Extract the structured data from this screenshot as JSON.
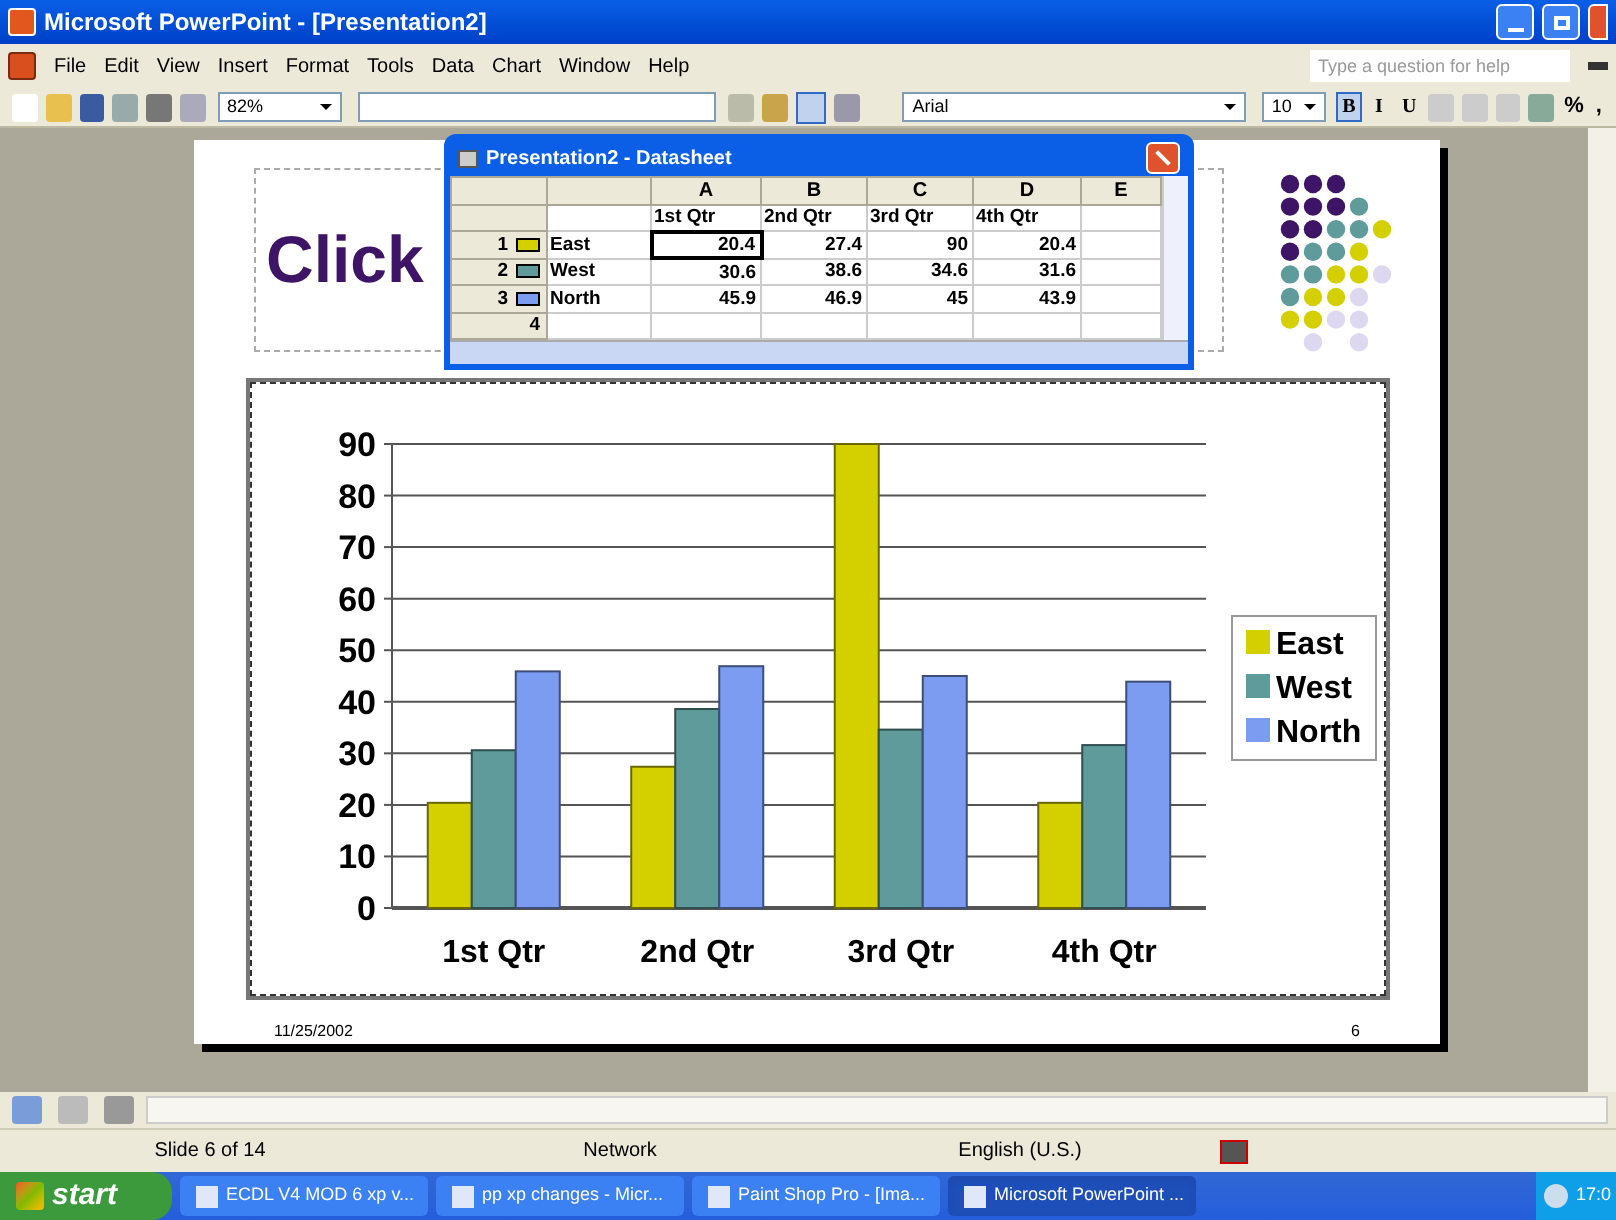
{
  "window": {
    "title": "Microsoft PowerPoint - [Presentation2]"
  },
  "menu": [
    "File",
    "Edit",
    "View",
    "Insert",
    "Format",
    "Tools",
    "Data",
    "Chart",
    "Window",
    "Help"
  ],
  "help_box": {
    "placeholder": "Type a question for help"
  },
  "toolbar": {
    "zoom": "82%",
    "font": "Arial",
    "font_size": "10",
    "format_buttons": [
      {
        "label": "B",
        "selected": true
      },
      {
        "label": "I",
        "selected": false
      },
      {
        "label": "U",
        "selected": false
      }
    ],
    "number_buttons": [
      "%",
      ","
    ]
  },
  "datasheet": {
    "title": "Presentation2 - Datasheet",
    "columns": [
      "A",
      "B",
      "C",
      "D",
      "E"
    ],
    "header": [
      "1st Qtr",
      "2nd Qtr",
      "3rd Qtr",
      "4th Qtr"
    ],
    "rows": [
      {
        "index": "1",
        "label": "East",
        "color": "#d4d000",
        "values": [
          {
            "text": "20.4",
            "selected": true
          },
          {
            "text": "27.4",
            "selected": false
          },
          {
            "text": "90",
            "selected": false
          },
          {
            "text": "20.4",
            "selected": false
          }
        ]
      },
      {
        "index": "2",
        "label": "West",
        "color": "#5f9b9b",
        "values": [
          {
            "text": "30.6",
            "selected": false
          },
          {
            "text": "38.6",
            "selected": false
          },
          {
            "text": "34.6",
            "selected": false
          },
          {
            "text": "31.6",
            "selected": false
          }
        ]
      },
      {
        "index": "3",
        "label": "North",
        "color": "#7b9cf0",
        "values": [
          {
            "text": "45.9",
            "selected": false
          },
          {
            "text": "46.9",
            "selected": false
          },
          {
            "text": "45",
            "selected": false
          },
          {
            "text": "43.9",
            "selected": false
          }
        ]
      },
      {
        "index": "4",
        "label": "",
        "color": "",
        "values": []
      }
    ]
  },
  "slide": {
    "title": "Click",
    "footer_date": "11/25/2002",
    "page_number": "6",
    "chart_data": {
      "type": "bar",
      "grid": true,
      "legend": "right",
      "categories": [
        "1st Qtr",
        "2nd Qtr",
        "3rd Qtr",
        "4th Qtr"
      ],
      "ylim": [
        0,
        90
      ],
      "yticks": [
        0,
        10,
        20,
        30,
        40,
        50,
        60,
        70,
        80,
        90
      ],
      "series": [
        {
          "name": "East",
          "color": "#d4d000",
          "values": [
            20.4,
            27.4,
            90,
            20.4
          ]
        },
        {
          "name": "West",
          "color": "#5f9b9b",
          "values": [
            30.6,
            38.6,
            34.6,
            31.6
          ]
        },
        {
          "name": "North",
          "color": "#7b9cf0",
          "values": [
            45.9,
            46.9,
            45,
            43.9
          ]
        }
      ]
    }
  },
  "status_bar": {
    "slide": "Slide 6 of 14",
    "design": "Network",
    "language": "English (U.S.)"
  },
  "taskbar": {
    "start": "start",
    "tasks": [
      {
        "label": "ECDL V4 MOD 6 xp v...",
        "selected": false
      },
      {
        "label": "pp xp changes - Micr...",
        "selected": false
      },
      {
        "label": "Paint Shop Pro - [Ima...",
        "selected": false
      },
      {
        "label": "Microsoft PowerPoint ...",
        "selected": true
      }
    ],
    "clock": "17:0"
  }
}
